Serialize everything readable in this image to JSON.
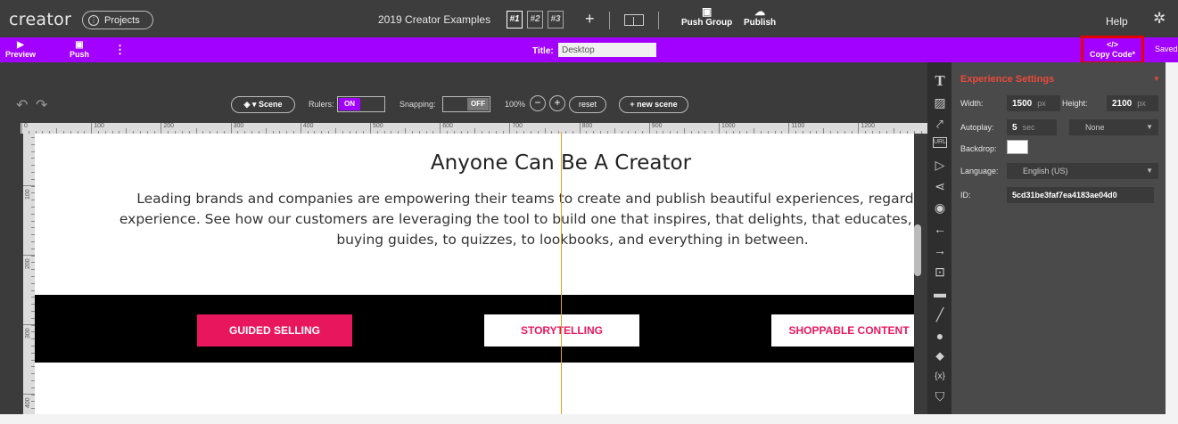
{
  "app": {
    "logo": "creator",
    "projects_label": "Projects",
    "document_title": "2019 Creator Examples"
  },
  "topbar": {
    "scene_tabs": [
      "#1",
      "#2",
      "#3"
    ],
    "add_scene": "+",
    "push_group": "Push Group",
    "publish": "Publish",
    "help": "Help"
  },
  "actionbar": {
    "preview": "Preview",
    "push": "Push",
    "title_label": "Title:",
    "title_value": "Desktop",
    "copy_code": "Copy Code*",
    "saved": "Saved"
  },
  "toolbar": {
    "scene": "Scene",
    "rulers_label": "Rulers:",
    "rulers_state": "ON",
    "snapping_label": "Snapping:",
    "snapping_state": "OFF",
    "zoom": "100%",
    "zoom_out": "−",
    "zoom_in": "+",
    "reset": "reset",
    "new_scene": "+ new scene"
  },
  "rulers": {
    "horizontal": [
      "0",
      "100",
      "200",
      "300",
      "400",
      "500",
      "600",
      "700",
      "800",
      "900",
      "1000",
      "1100",
      "1200"
    ],
    "vertical": [
      "100",
      "200",
      "300",
      "400"
    ]
  },
  "stage": {
    "headline": "Anyone Can Be A Creator",
    "body": "Leading brands and companies are empowering their teams to create and publish beautiful experiences, regardless of design experience. See how our customers are leveraging the tool to build one that inspires, that delights, that educates, and more. From buying guides, to quizzes, to lookbooks, and everything in between.",
    "buttons": [
      "GUIDED SELLING",
      "STORYTELLING",
      "SHOPPABLE CONTENT"
    ]
  },
  "panel": {
    "title": "Experience Settings",
    "width_label": "Width:",
    "width_value": "1500",
    "height_label": "Height:",
    "height_value": "2100",
    "unit_px": "px",
    "autoplay_label": "Autoplay:",
    "autoplay_value": "5",
    "unit_sec": "sec",
    "transition": "None",
    "backdrop_label": "Backdrop:",
    "language_label": "Language:",
    "language_value": "English (US)",
    "id_label": "ID:",
    "id_value": "5cd31be3faf7ea4183ae04d0"
  },
  "colors": {
    "accent_purple": "#a200ff",
    "cta_pink": "#e8175d",
    "panel_title": "#e84a3c",
    "highlight_box": "#e60000"
  }
}
